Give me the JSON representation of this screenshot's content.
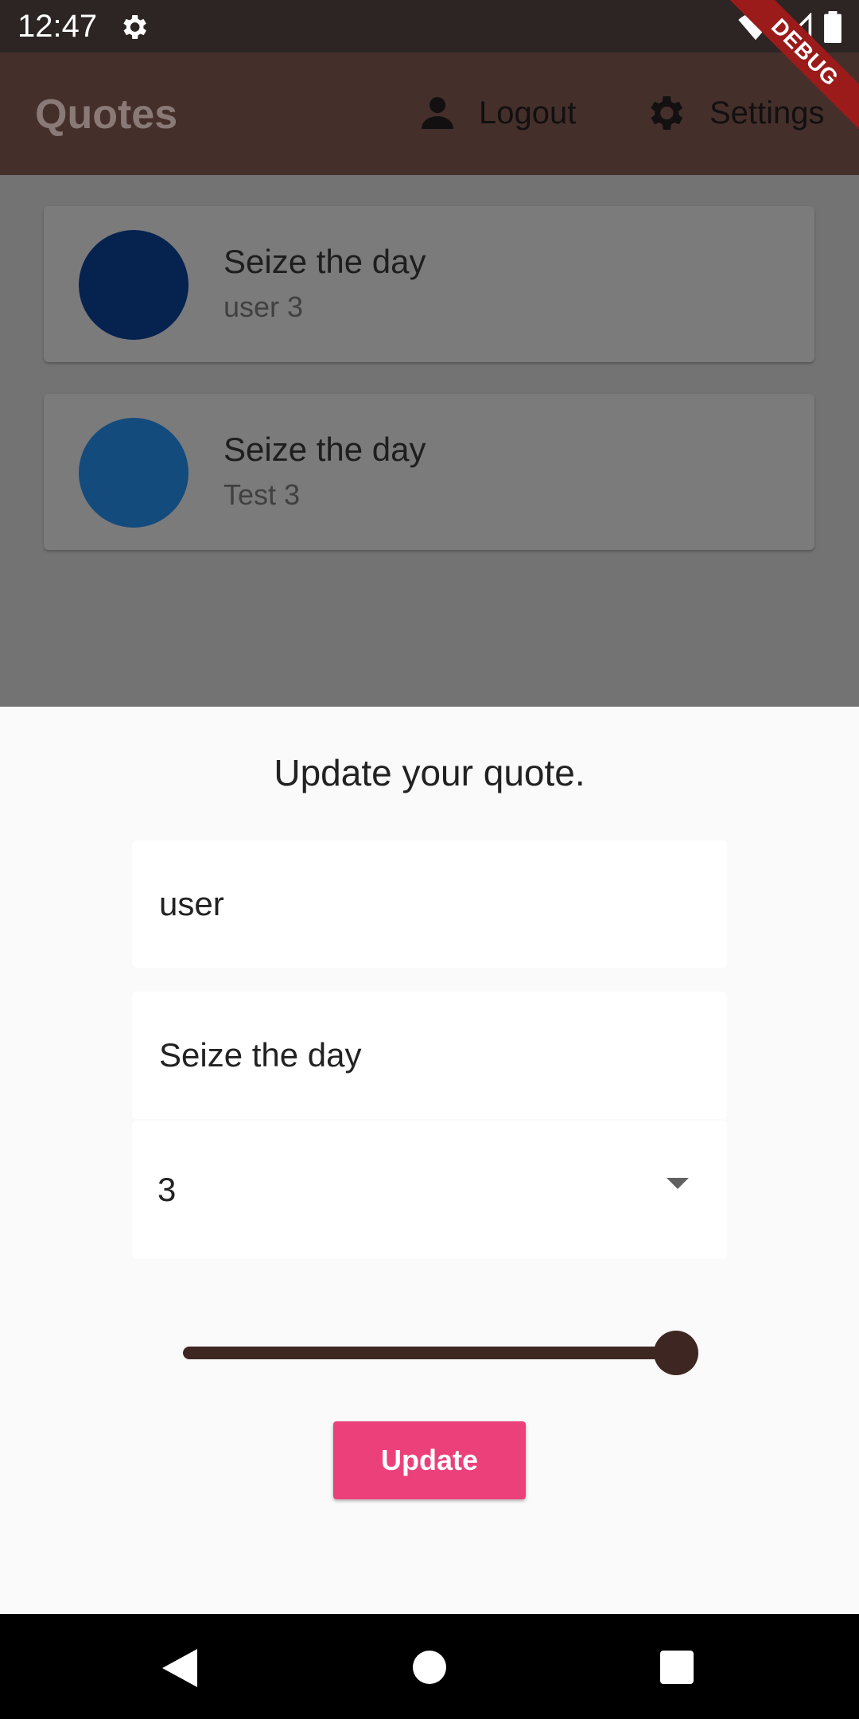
{
  "status_bar": {
    "time": "12:47"
  },
  "debug_banner": "DEBUG",
  "app_bar": {
    "title": "Quotes",
    "logout_label": "Logout",
    "settings_label": "Settings"
  },
  "quotes": [
    {
      "title": "Seize the day",
      "subtitle": "user 3",
      "avatar_color": "#06224f"
    },
    {
      "title": "Seize the day",
      "subtitle": "Test 3",
      "avatar_color": "#134b7c"
    }
  ],
  "sheet": {
    "title": "Update your quote.",
    "name_value": "user",
    "quote_value": "Seize the day",
    "rating_value": "3",
    "slider_value_fraction": 1.0,
    "button_label": "Update"
  },
  "colors": {
    "accent": "#ec407a",
    "primary": "#3e2723"
  }
}
